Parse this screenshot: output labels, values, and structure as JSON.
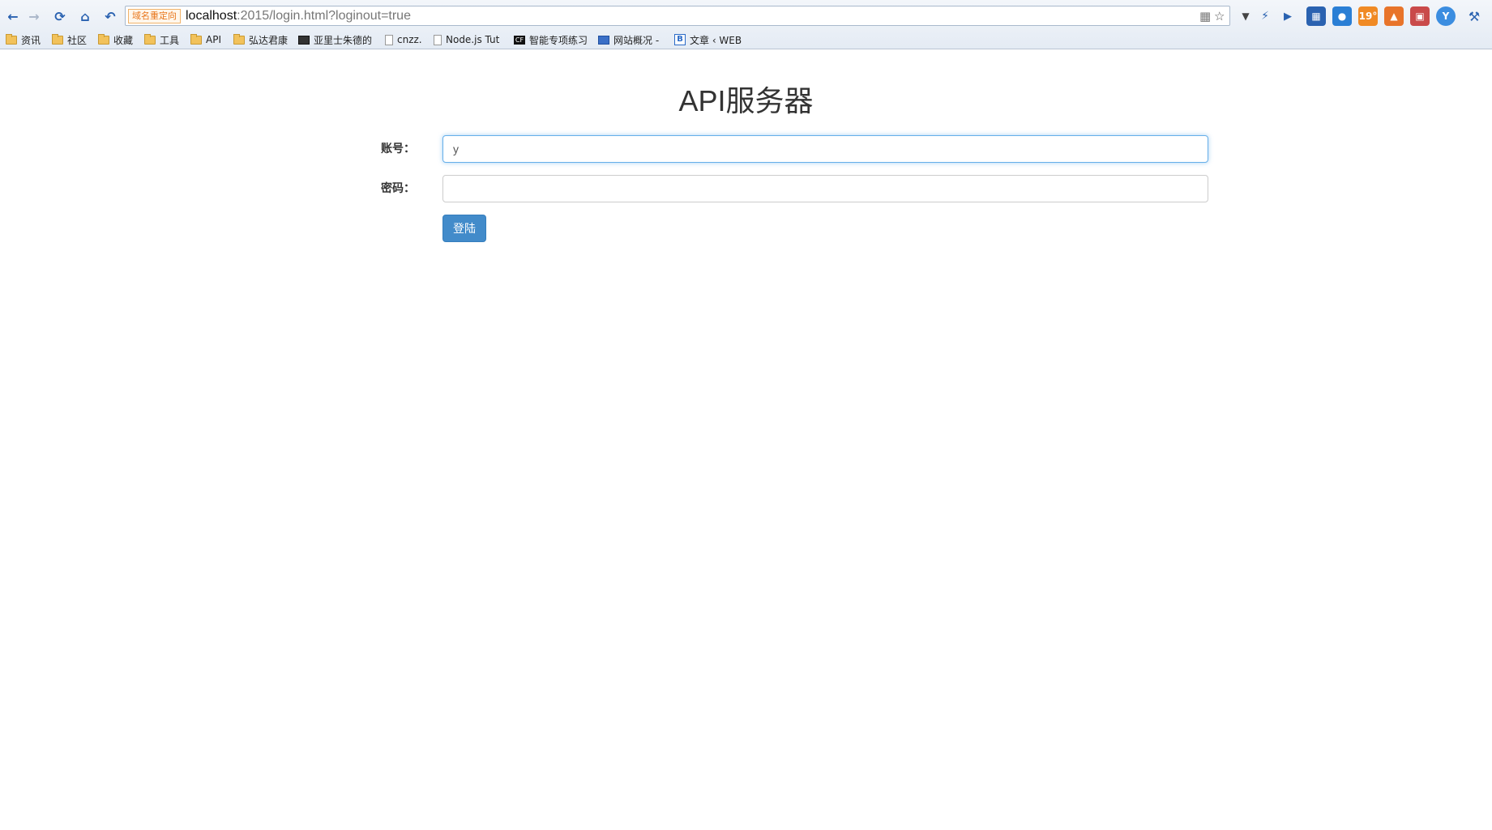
{
  "browser": {
    "redirect_badge": "域名重定向",
    "url_host": "localhost",
    "url_rest": ":2015/login.html?loginout=true",
    "accent_color": "#2a62b0"
  },
  "bookmarks": [
    {
      "label": "资讯",
      "icon": "folder-icon"
    },
    {
      "label": "社区",
      "icon": "folder-icon"
    },
    {
      "label": "收藏",
      "icon": "folder-icon"
    },
    {
      "label": "工具",
      "icon": "folder-icon"
    },
    {
      "label": "API",
      "icon": "folder-icon"
    },
    {
      "label": "弘达君康",
      "icon": "folder-icon"
    },
    {
      "label": "亚里士朱德的",
      "icon": "image-icon"
    },
    {
      "label": "cnzz.",
      "icon": "page-icon"
    },
    {
      "label": "Node.js Tut",
      "icon": "page-icon"
    },
    {
      "label": "智能专项练习",
      "icon": "cf-icon"
    },
    {
      "label": "网站概况 -",
      "icon": "chart-icon"
    },
    {
      "label": "文章 ‹ WEB",
      "icon": "blog-icon"
    }
  ],
  "page": {
    "title": "API服务器",
    "account_label": "账号：",
    "account_value": "y",
    "password_label": "密码：",
    "password_value": "",
    "login_button": "登陆",
    "button_color": "#428bca"
  }
}
